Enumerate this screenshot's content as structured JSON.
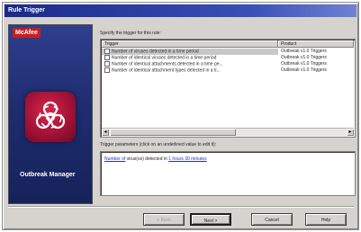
{
  "window": {
    "title": "Rule Trigger"
  },
  "banner": {
    "brand": "McAfee",
    "product_name": "Outbreak Manager",
    "emblem_icon": "biohazard-icon"
  },
  "triggers": {
    "instruction": "Specify the trigger for this rule:",
    "columns": [
      "Trigger",
      "Product"
    ],
    "rows": [
      {
        "trigger": "Number of viruses detected in a time period",
        "product": "Outbreak v1.0 Triggers",
        "selected": true
      },
      {
        "trigger": "Number of identical viruses detected in a time period",
        "product": "Outbreak v1.0 Triggers",
        "selected": false
      },
      {
        "trigger": "Number of identical attachments detected in a time pe...",
        "product": "Outbreak v1.0 Triggers",
        "selected": false
      },
      {
        "trigger": "Number of identical attachment types detected in a ti...",
        "product": "Outbreak v1.0 Triggers",
        "selected": false
      }
    ]
  },
  "parameters": {
    "label": "Trigger parameters (click on an underlined value to edit it):",
    "prefix_link": "Number of",
    "middle_text": "virus(es) detected in",
    "suffix_link": "1 hours 30 minutes"
  },
  "buttons": {
    "back": "< Back",
    "next": "Next >",
    "cancel": "Cancel",
    "help": "Help"
  },
  "colors": {
    "title_bar": "#1a2a8a",
    "banner": "#1f2d70",
    "brand_badge": "#c81e1e",
    "emblem": "#9e1035",
    "link": "#2230c8"
  }
}
